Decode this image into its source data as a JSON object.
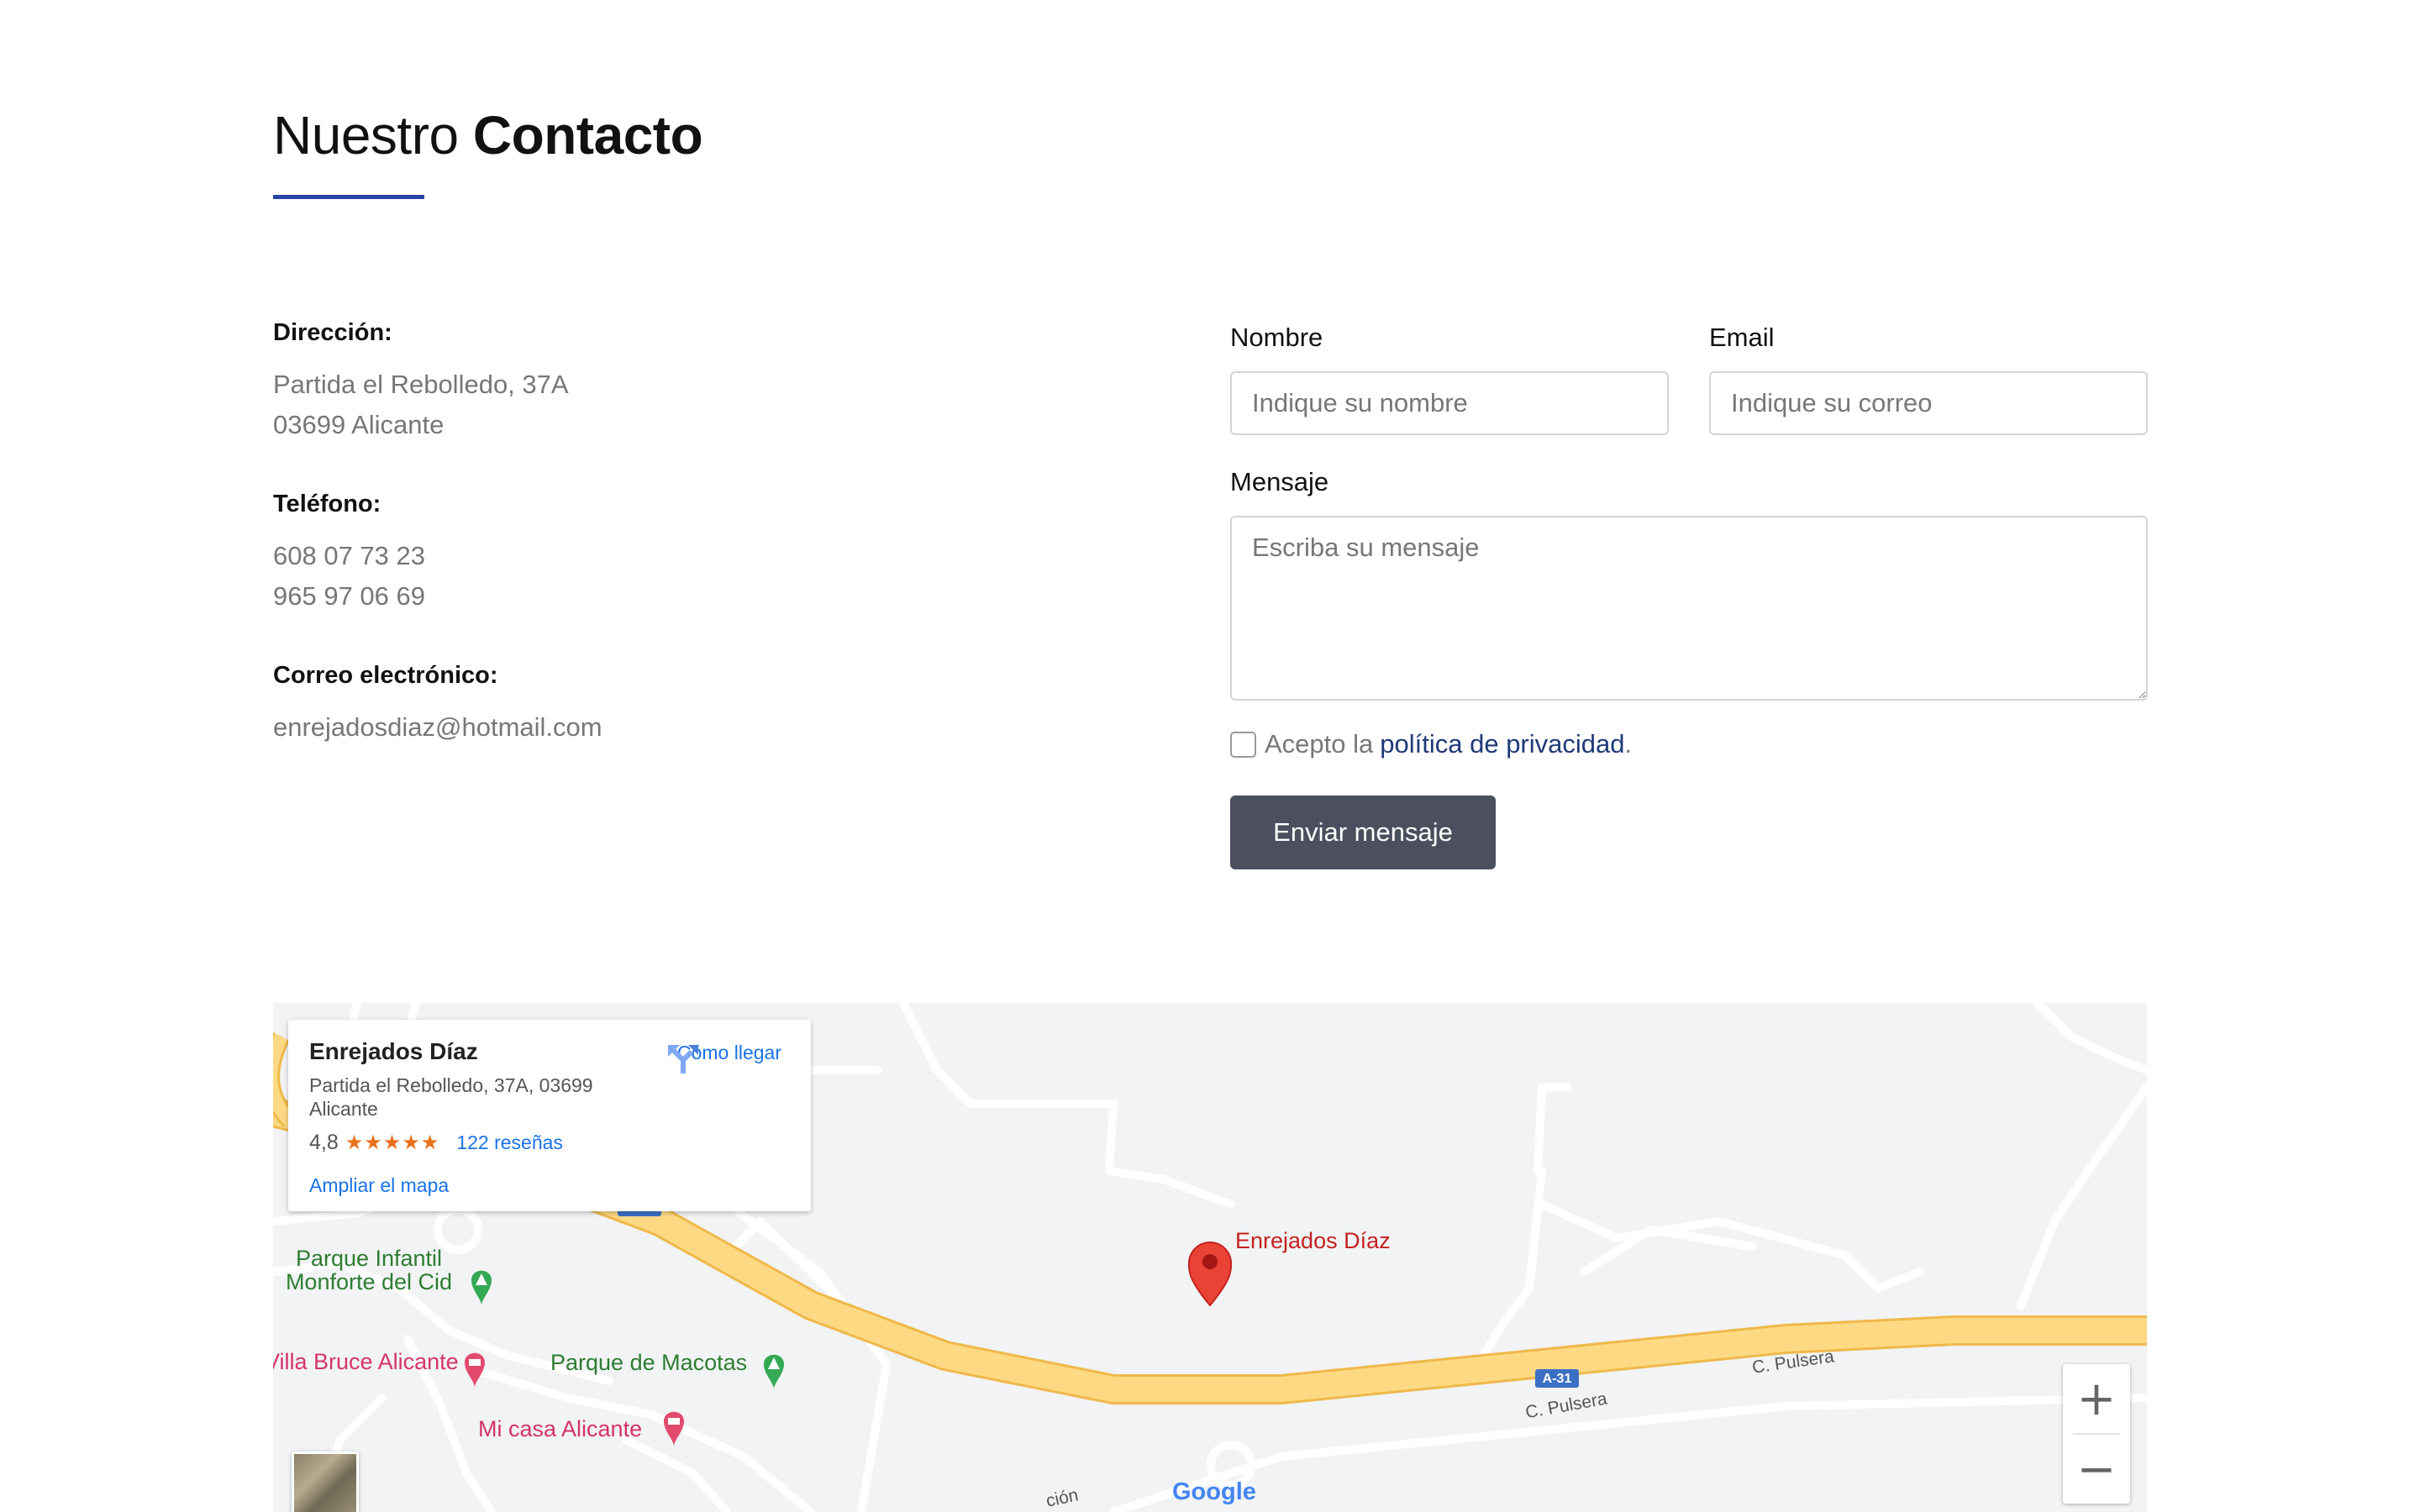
{
  "heading": {
    "normal": "Nuestro",
    "bold": "Contacto"
  },
  "contact_info": {
    "address_label": "Dirección:",
    "address_line1": "Partida el Rebolledo, 37A",
    "address_line2": "03699 Alicante",
    "phone_label": "Teléfono:",
    "phone1": "608 07 73 23",
    "phone2": "965 97 06 69",
    "email_label": "Correo electrónico:",
    "email": "enrejadosdiaz@hotmail.com"
  },
  "form": {
    "name_label": "Nombre",
    "name_placeholder": "Indique su nombre",
    "email_label": "Email",
    "email_placeholder": "Indique su correo",
    "message_label": "Mensaje",
    "message_placeholder": "Escriba su mensaje",
    "privacy_text": "Acepto la",
    "privacy_link": "política de privacidad",
    "privacy_end": ".",
    "submit_label": "Enviar mensaje"
  },
  "map": {
    "place_name": "Enrejados Díaz",
    "place_address": "Partida el Rebolledo, 37A, 03699 Alicante",
    "rating": "4,8",
    "stars": "★★★★★",
    "reviews": "122 reseñas",
    "directions": "Cómo llegar",
    "enlarge": "Ampliar el mapa",
    "marker_label": "Enrejados Díaz",
    "park1": "Parque Infantil Monforte del Cid",
    "park2": "Parque de Macotas",
    "hotel1": "Villa Bruce Alicante",
    "hotel2": "Mi casa Alicante",
    "road_a31": "A-31",
    "road1": "C. Pulsera",
    "road2": "C. Pulsera",
    "road_partial": "ción",
    "zoom_in": "+",
    "zoom_out": "−",
    "google": "Google",
    "colors": {
      "highway": "#fdd984",
      "highway_edge": "#f0b84a",
      "road": "#ffffff",
      "bg": "#f1f3f4",
      "marker": "#ea4335"
    }
  },
  "accent_color": "#2a43a8",
  "button_color": "#4b4f5e"
}
